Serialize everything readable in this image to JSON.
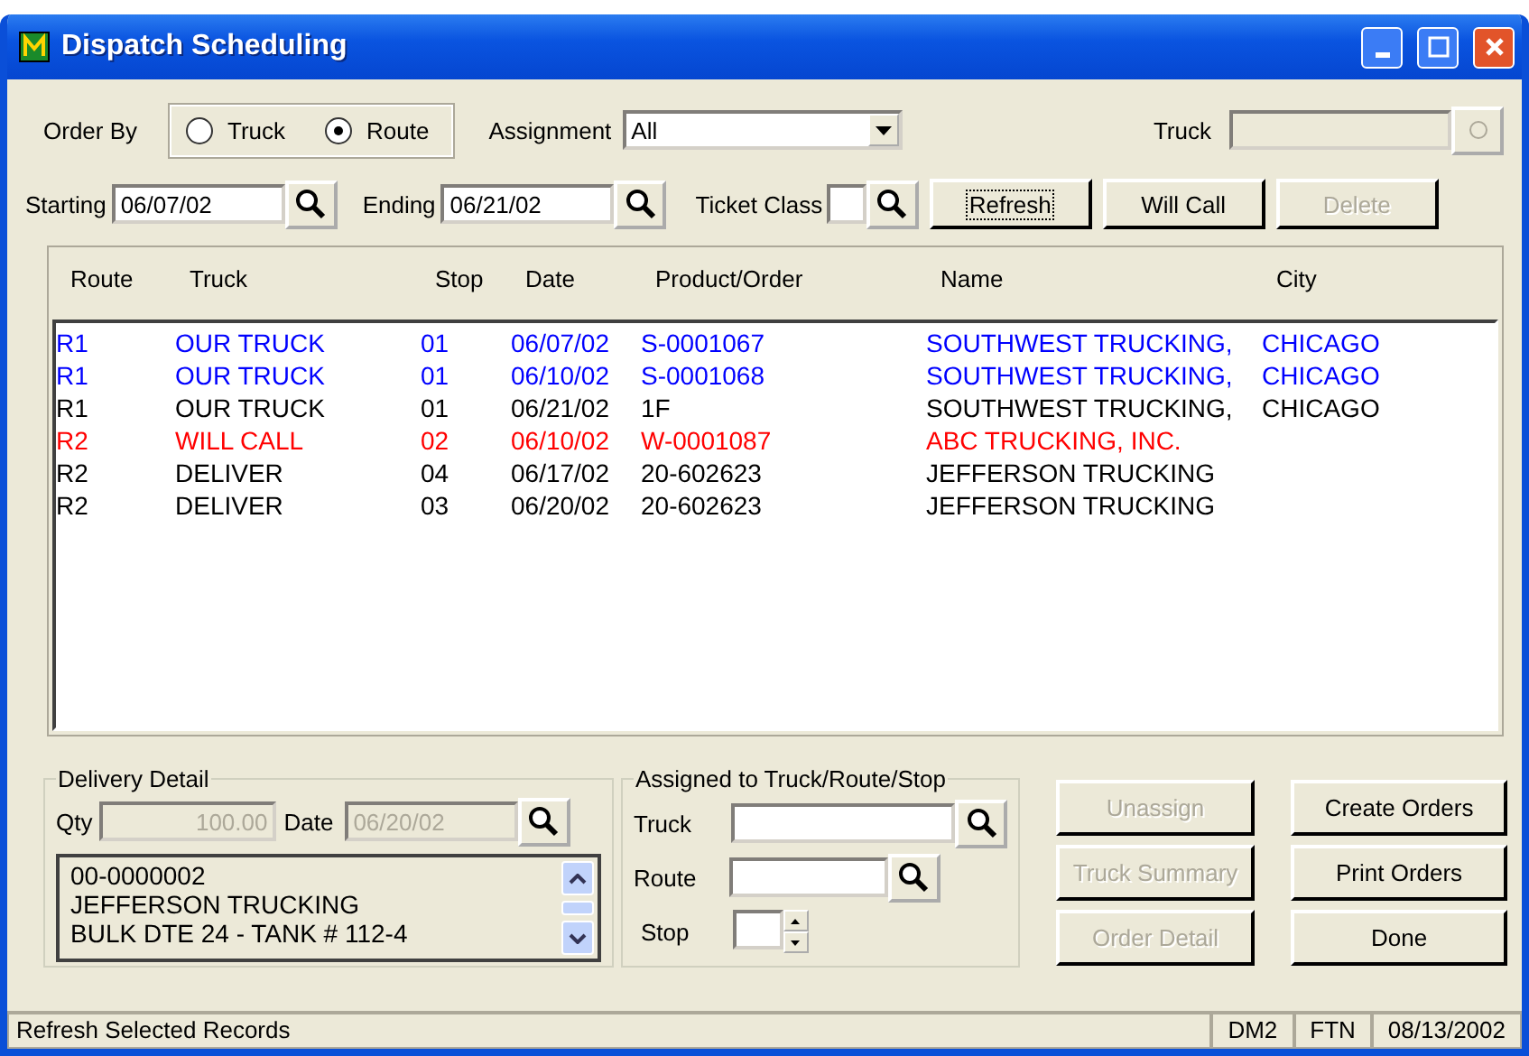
{
  "window": {
    "title": "Dispatch Scheduling"
  },
  "order_by": {
    "label": "Order By",
    "options": [
      {
        "label": "Truck",
        "selected": false
      },
      {
        "label": "Route",
        "selected": true
      }
    ]
  },
  "assignment": {
    "label": "Assignment",
    "value": "All"
  },
  "truck_filter": {
    "label": "Truck",
    "disabled": true
  },
  "starting": {
    "label": "Starting",
    "value": "06/07/02"
  },
  "ending": {
    "label": "Ending",
    "value": "06/21/02"
  },
  "ticket_class": {
    "label": "Ticket Class"
  },
  "top_buttons": [
    {
      "label": "Refresh",
      "disabled": false,
      "focused": true
    },
    {
      "label": "Will Call",
      "disabled": false,
      "focused": false
    },
    {
      "label": "Delete",
      "disabled": true,
      "focused": false
    }
  ],
  "table": {
    "columns": [
      "Route",
      "Truck",
      "Stop",
      "Date",
      "Product/Order",
      "Name",
      "City"
    ],
    "rows": [
      {
        "color": "#0000ff",
        "cells": [
          "R1",
          "OUR TRUCK",
          "01",
          "06/07/02",
          "S-0001067",
          "SOUTHWEST TRUCKING,",
          "CHICAGO"
        ]
      },
      {
        "color": "#0000ff",
        "cells": [
          "R1",
          "OUR TRUCK",
          "01",
          "06/10/02",
          "S-0001068",
          "SOUTHWEST TRUCKING,",
          "CHICAGO"
        ]
      },
      {
        "color": "#000000",
        "cells": [
          "R1",
          "OUR TRUCK",
          "01",
          "06/21/02",
          "1F",
          "SOUTHWEST TRUCKING,",
          "CHICAGO"
        ]
      },
      {
        "color": "#ff0000",
        "cells": [
          "R2",
          "WILL CALL",
          "02",
          "06/10/02",
          "W-0001087",
          "ABC TRUCKING, INC.",
          ""
        ]
      },
      {
        "color": "#000000",
        "cells": [
          "R2",
          "DELIVER",
          "04",
          "06/17/02",
          "20-602623",
          "JEFFERSON TRUCKING",
          ""
        ]
      },
      {
        "color": "#000000",
        "cells": [
          "R2",
          "DELIVER",
          "03",
          "06/20/02",
          "20-602623",
          "JEFFERSON TRUCKING",
          ""
        ]
      }
    ]
  },
  "delivery_detail": {
    "title": "Delivery Detail",
    "qty_label": "Qty",
    "qty": "100.00",
    "date_label": "Date",
    "date": "06/20/02",
    "notes": [
      "00-0000002",
      "JEFFERSON TRUCKING",
      "BULK DTE 24 - TANK # 112-4"
    ]
  },
  "assigned": {
    "title": "Assigned to Truck/Route/Stop",
    "truck_label": "Truck",
    "route_label": "Route",
    "stop_label": "Stop"
  },
  "bottom_buttons": [
    {
      "label": "Unassign",
      "disabled": true
    },
    {
      "label": "Create Orders",
      "disabled": false
    },
    {
      "label": "Truck Summary",
      "disabled": true
    },
    {
      "label": "Print Orders",
      "disabled": false
    },
    {
      "label": "Order Detail",
      "disabled": true
    },
    {
      "label": "Done",
      "disabled": false
    }
  ],
  "status_bar": {
    "message": "Refresh Selected Records",
    "panels": [
      "DM2",
      "FTN",
      "08/13/2002"
    ]
  }
}
